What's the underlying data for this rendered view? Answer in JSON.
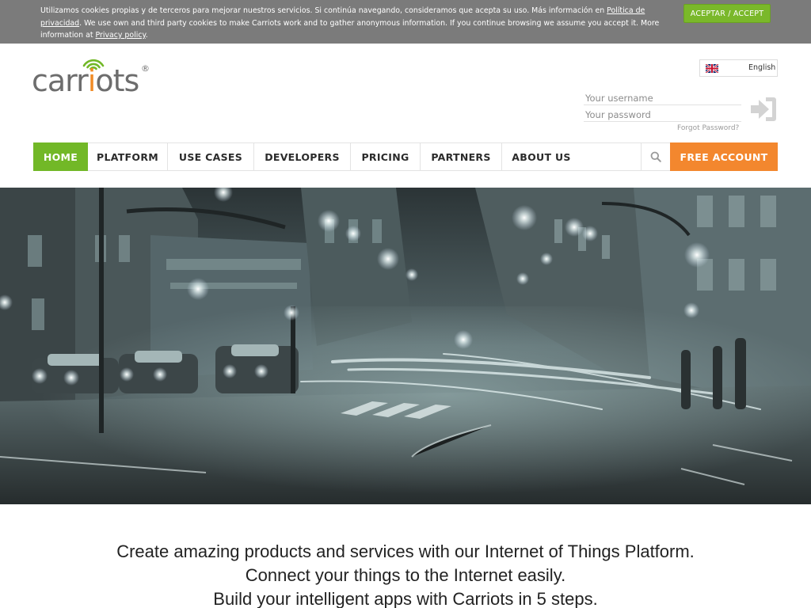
{
  "cookie": {
    "text_es": "Utilizamos cookies propias y de terceros para mejorar nuestros servicios. Si continúa navegando, consideramos que acepta su uso. Más información en ",
    "privacy_es_link": "Política de privacidad",
    "text_en": ". We use own and third party cookies to make Carriots work and to gather anonymous information. If you continue browsing we assume you accept it. More information at ",
    "privacy_en_link": "Privacy policy",
    "text_end": ".",
    "accept_label": "ACEPTAR / ACCEPT"
  },
  "brand": {
    "name_pre": "carr",
    "name_i": "i",
    "name_post": "ots",
    "registered": "®",
    "colors": {
      "green": "#72b827",
      "orange": "#f3872e",
      "grey": "#6d6d6d"
    }
  },
  "language": {
    "selected": "English",
    "flag_icon": "uk-flag-icon"
  },
  "login": {
    "username_placeholder": "Your username",
    "password_placeholder": "Your password",
    "forgot_label": "Forgot Password?",
    "submit_icon": "sign-in-icon"
  },
  "nav": {
    "items": [
      {
        "label": "HOME",
        "active": true
      },
      {
        "label": "PLATFORM"
      },
      {
        "label": "USE CASES"
      },
      {
        "label": "DEVELOPERS"
      },
      {
        "label": "PRICING"
      },
      {
        "label": "PARTNERS"
      },
      {
        "label": "ABOUT US"
      }
    ],
    "search_icon": "search-icon",
    "free_account_label": "FREE ACCOUNT"
  },
  "hero": {
    "image": "night-city-street-photo"
  },
  "tagline": {
    "line1": "Create amazing products and services with our Internet of Things Platform.",
    "line2": "Connect your things to the Internet easily.",
    "line3": "Build your intelligent apps with Carriots in 5 steps."
  }
}
